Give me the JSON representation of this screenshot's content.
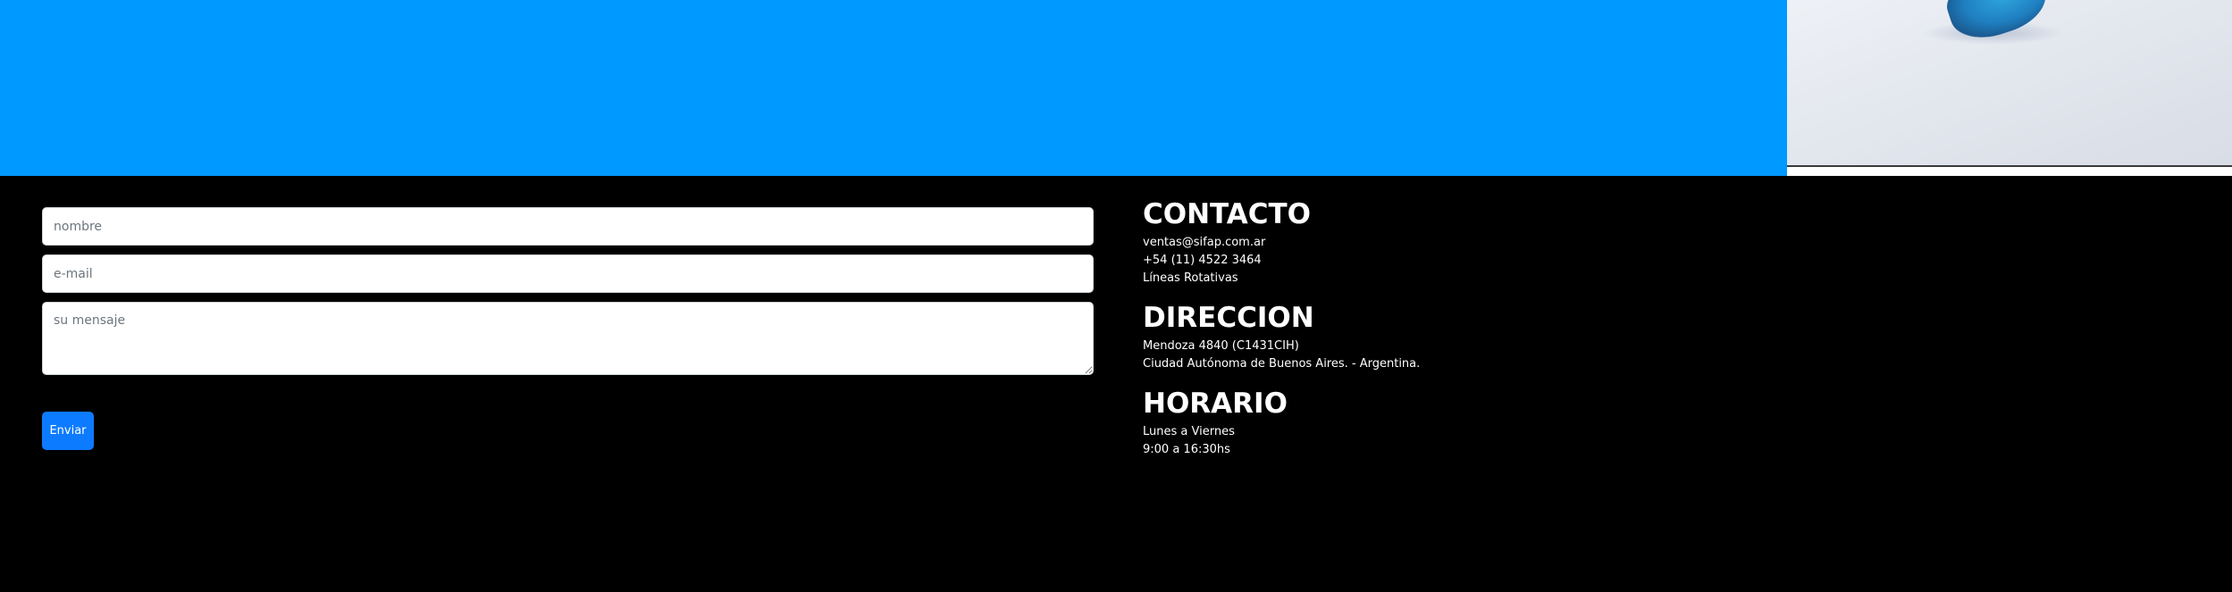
{
  "form": {
    "name_placeholder": "nombre",
    "email_placeholder": "e-mail",
    "message_placeholder": "su mensaje",
    "submit_label": "Enviar"
  },
  "contact": {
    "heading": "CONTACTO",
    "email": "ventas@sifap.com.ar",
    "phone": "+54 (11) 4522 3464",
    "lines": "Líneas Rotativas"
  },
  "address": {
    "heading": "DIRECCION",
    "street": "Mendoza 4840 (C1431CIH)",
    "city": "Ciudad Autónoma de Buenos Aires. - Argentina."
  },
  "hours": {
    "heading": "HORARIO",
    "days": "Lunes a Viernes",
    "time": "9:00 a 16:30hs"
  },
  "colors": {
    "hero_blue": "#0099ff",
    "footer_bg": "#000000",
    "button_blue": "#0d7bff"
  }
}
